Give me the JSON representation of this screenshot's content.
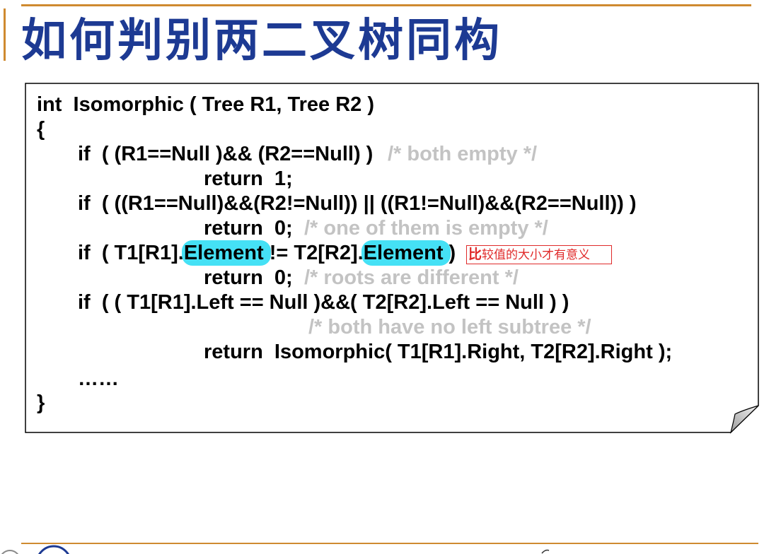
{
  "theme": {
    "accent_color": "#cf8a30",
    "title_color": "#1d3a93",
    "comment_color": "#c3c3c3",
    "highlight_color": "#45e1f5",
    "annotation_color": "#e02a2a"
  },
  "slide": {
    "title": "如何判别两二叉树同构"
  },
  "code": {
    "signature": "int  Isomorphic ( Tree R1, Tree R2 )",
    "open_brace": "{",
    "if_both_null": "if  ( (R1==Null )&& (R2==Null) )",
    "comment_both_empty": "/* both empty */",
    "return_one": "return  1;",
    "if_one_null": "if  ( ((R1==Null)&&(R2!=Null)) || ((R1!=Null)&&(R2==Null)) )",
    "return_zero_a": "return  0;",
    "comment_one_empty": "/* one of them is empty */",
    "if_elements": {
      "prefix": "if  ( T1[R1].",
      "field_left": "Element",
      "operator": " != T2[R2].",
      "field_right": "Element",
      "suffix": " )"
    },
    "return_zero_b": "return  0;",
    "comment_roots_different": "/* roots are different */",
    "if_left_null": "if  ( ( T1[R1].Left == Null )&&( T2[R2].Left == Null ) )",
    "comment_no_left_subtree": "/* both have no left subtree */",
    "return_recursive": "return  Isomorphic( T1[R1].Right, T2[R2].Right );",
    "ellipsis": "……",
    "close_brace": "}"
  },
  "annotation": {
    "lead": "比",
    "rest": "较值的大小才有意义"
  }
}
